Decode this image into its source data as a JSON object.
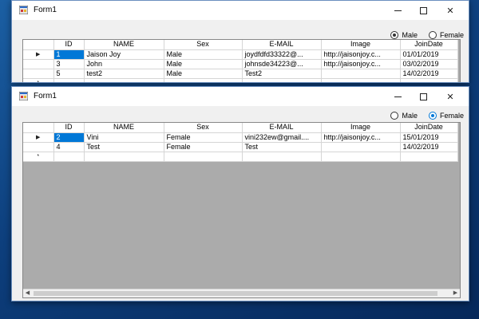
{
  "columns": [
    "ID",
    "NAME",
    "Sex",
    "E-MAIL",
    "Image",
    "JoinDate"
  ],
  "form1": {
    "title": "Form1",
    "radio_male": "Male",
    "radio_female": "Female",
    "male_checked": true,
    "rows": [
      {
        "marker": "▶",
        "id": "1",
        "name": "Jaison Joy",
        "sex": "Male",
        "email": "joydfdfd33322@...",
        "image": "http://jaisonjoy.c...",
        "date": "01/01/2019"
      },
      {
        "marker": "",
        "id": "3",
        "name": "John",
        "sex": "Male",
        "email": "johnsde34223@...",
        "image": "http://jaisonjoy.c...",
        "date": "03/02/2019"
      },
      {
        "marker": "",
        "id": "5",
        "name": "test2",
        "sex": "Male",
        "email": "Test2",
        "image": "",
        "date": "14/02/2019"
      },
      {
        "marker": "*",
        "id": "",
        "name": "",
        "sex": "",
        "email": "",
        "image": "",
        "date": ""
      }
    ]
  },
  "form2": {
    "title": "Form1",
    "radio_male": "Male",
    "radio_female": "Female",
    "female_checked": true,
    "rows": [
      {
        "marker": "▶",
        "id": "2",
        "name": "Vini",
        "sex": "Female",
        "email": "vini232ew@gmail....",
        "image": "http://jaisonjoy.c...",
        "date": "15/01/2019"
      },
      {
        "marker": "",
        "id": "4",
        "name": "Test",
        "sex": "Female",
        "email": "Test",
        "image": "",
        "date": "14/02/2019"
      },
      {
        "marker": "*",
        "id": "",
        "name": "",
        "sex": "",
        "email": "",
        "image": "",
        "date": ""
      }
    ]
  },
  "colors": {
    "selection": "#0078d7",
    "grid_background": "#ababab",
    "desktop": "#0d3f7d"
  },
  "icons": {
    "app": "form-app-icon",
    "min": "minimize-icon",
    "max": "maximize-icon",
    "close": "close-icon"
  }
}
